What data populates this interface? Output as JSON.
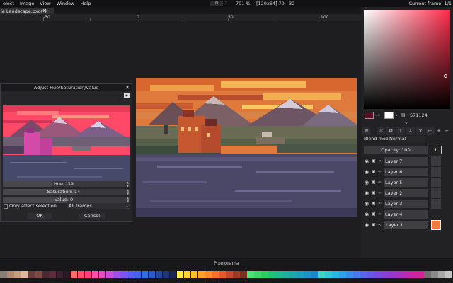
{
  "menubar": {
    "items": [
      "elect",
      "Image",
      "View",
      "Window",
      "Help"
    ],
    "frame_value": "0",
    "frame_unit": "°",
    "zoom": "701 %",
    "canvas_size": "[120x64]",
    "cursor": "-70, -32",
    "current_frame": "Current frame: 1/1"
  },
  "tab": {
    "label": "le Landscape.pxo(*)",
    "close": "✕"
  },
  "ruler": {
    "labels": [
      "-50",
      "0",
      "50",
      "100"
    ]
  },
  "dialog": {
    "title": "Adjust Hue/Saturation/Value",
    "close": "✕",
    "hue_label": "Hue: -39",
    "hue_level": 0.39,
    "saturation_label": "Saturation: 14",
    "saturation_level": 0.57,
    "value_label": "Value: 0",
    "value_level": 0.5,
    "only_affect_selection": "Only affect selection",
    "frames_option": "All frames",
    "ok": "OK",
    "cancel": "Cancel"
  },
  "colors": {
    "primary": "#571124",
    "secondary": "#ffffff",
    "hex_value": "571124",
    "accent_thumb": "#f07b3f"
  },
  "layers_panel": {
    "blend_mode_label": "Blend mode:",
    "blend_mode_value": "Normal",
    "opacity_label": "Opacity: 100",
    "frame_header": "1",
    "layers": [
      "Layer 7",
      "Layer 6",
      "Layer 5",
      "Layer 2",
      "Layer 3",
      "Layer 4",
      "Layer 1"
    ],
    "active_layer": "Layer 1"
  },
  "palette": {
    "title": "Pixelorama",
    "swatches": [
      "#8a7d74",
      "#b08a72",
      "#c79b7d",
      "#e0b79a",
      "#6a3b3b",
      "#7e4a45",
      "#4a2a35",
      "#5d2f3e",
      "#3a2030",
      "#2a1a25",
      "#ff6b6b",
      "#ff4f6d",
      "#ff3d7f",
      "#ff4fa6",
      "#e34fbf",
      "#c84fd6",
      "#a24fe6",
      "#7f54f0",
      "#5b5ff0",
      "#4363e8",
      "#2f6fe0",
      "#2a5ac8",
      "#26489f",
      "#203670",
      "#1c2750",
      "#ffe94a",
      "#ffd23a",
      "#ffbd2f",
      "#ffa12a",
      "#ff8a2a",
      "#f7712d",
      "#e05a2c",
      "#c24a2b",
      "#9e3a28",
      "#7a2e24",
      "#4ee27a",
      "#3ed86a",
      "#2ccf63",
      "#22c27a",
      "#21b78f",
      "#1fb09f",
      "#1ea8ae",
      "#1c9fbf",
      "#1b92c9",
      "#1a85d0",
      "#3fd6c9",
      "#32c7d8",
      "#28b6e4",
      "#2ea2ea",
      "#3a8ced",
      "#4a78ee",
      "#5a66ec",
      "#6a56e6",
      "#7a4ae0",
      "#8a40d6",
      "#9a38cc",
      "#aa30c0",
      "#ba2ab2",
      "#c826a4",
      "#d42396",
      "#6f6f6f",
      "#8a8a8a",
      "#a6a6a6",
      "#c2c2c2"
    ]
  }
}
